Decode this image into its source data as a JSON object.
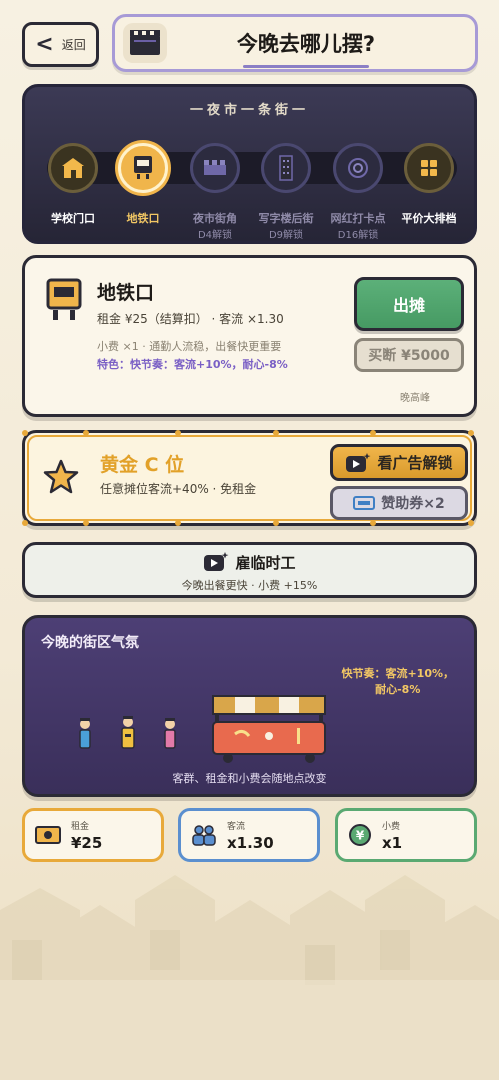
{
  "header": {
    "back_label": "返回",
    "title": "今晚去哪儿摆?"
  },
  "street": {
    "title": "一夜市一条街一",
    "nodes": [
      {
        "label": "学校门口",
        "sub": "",
        "state": "unlocked"
      },
      {
        "label": "地铁口",
        "sub": "",
        "state": "selected"
      },
      {
        "label": "夜市街角",
        "sub": "D4解锁",
        "state": "locked"
      },
      {
        "label": "写字楼后街",
        "sub": "D9解锁",
        "state": "locked"
      },
      {
        "label": "网红打卡点",
        "sub": "D16解锁",
        "state": "locked"
      },
      {
        "label": "平价大排档",
        "sub": "",
        "state": "unlocked"
      }
    ]
  },
  "location": {
    "name": "地铁口",
    "line1": "租金 ¥25（结算扣） · 客流 ×1.30",
    "line2": "小费 ×1 · 通勤人流稳，出餐快更重要",
    "line3": "特色：快节奏：客流+10%，耐心-8%",
    "go_label": "出摊",
    "buy_label": "买断 ¥5000",
    "peak_label": "晚高峰"
  },
  "gold_slot": {
    "title": "黄金 C 位",
    "subtitle": "任意摊位客流+40% · 免租金",
    "ad_label": "看广告解锁",
    "coupon_label": "赞助券×2"
  },
  "hire": {
    "title": "雇临时工",
    "subtitle": "今晚出餐更快 · 小费 +15%"
  },
  "atmosphere": {
    "title": "今晚的街区气氛",
    "note_line1": "快节奏：客流+10%，",
    "note_line2": "耐心-8%",
    "footer": "客群、租金和小费会随地点改变"
  },
  "stats": [
    {
      "key": "租金",
      "value": "¥25",
      "color": "#e8a93a",
      "icon": "money-icon"
    },
    {
      "key": "客流",
      "value": "x1.30",
      "color": "#5b8fcf",
      "icon": "people-icon"
    },
    {
      "key": "小费",
      "value": "x1",
      "color": "#5aa972",
      "icon": "yen-coin-icon"
    }
  ],
  "colors": {
    "accent_gold": "#e8a93a",
    "go_green": "#4fa56b",
    "street_bg": "#2f2e44",
    "atmo_bg": "#433866",
    "special_purple": "#7a5fc5"
  }
}
